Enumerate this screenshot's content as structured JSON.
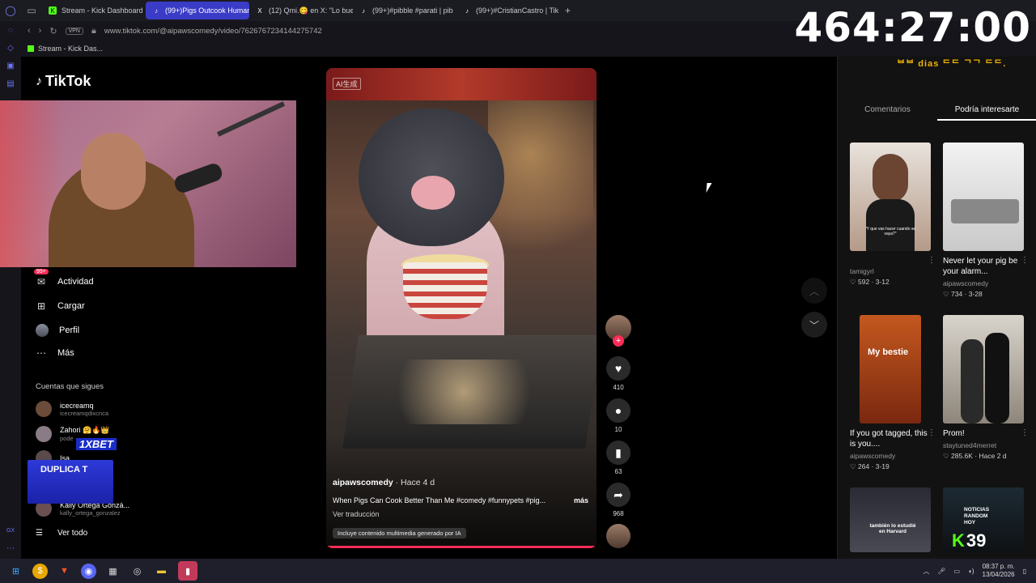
{
  "browser": {
    "tabs": [
      {
        "label": "Stream - Kick Dashboard",
        "fav_color": "#53fc18",
        "fav_glyph": "K"
      },
      {
        "label": "(99+)Pigs Outcook Human",
        "fav_color": "#111111",
        "fav_glyph": "♪",
        "active": true
      },
      {
        "label": "(12) Qmi.😋 en X: \"Lo buen",
        "fav_color": "#000000",
        "fav_glyph": "X"
      },
      {
        "label": "(99+)#pibble #parati | pib",
        "fav_color": "#111111",
        "fav_glyph": "♪"
      },
      {
        "label": "(99+)#CristianCastro | Tik",
        "fav_color": "#111111",
        "fav_glyph": "♪"
      }
    ],
    "vpn_label": "VPN",
    "url": "www.tiktok.com/@aipawscomedy/video/7626767234144275742",
    "bookmark": "Stream - Kick Das..."
  },
  "overlay": {
    "timer": "464:27:00",
    "days_partial": "ᄇᄇ dias ᄃᄃ ᄀᄀ ᄃᄃ."
  },
  "tiktok": {
    "logo_text": "TikTok",
    "nav": [
      {
        "label": "Actividad",
        "icon": "inbox-icon",
        "badge": "99+"
      },
      {
        "label": "Cargar",
        "icon": "upload-icon"
      },
      {
        "label": "Perfil",
        "icon": "profile-avatar"
      },
      {
        "label": "Más",
        "icon": "more-icon"
      }
    ],
    "following_title": "Cuentas que sigues",
    "accounts": [
      {
        "name": "icecreamq",
        "handle": "icecreamqdixcnca"
      },
      {
        "name": "Zahori 🤗🔥👑",
        "handle": "pode"
      },
      {
        "name": "Isa",
        "handle": ""
      },
      {
        "name": "Kally Ortega Gonzá...",
        "handle": "kally_ortega_gonzalez"
      }
    ],
    "see_all": "Ver todo",
    "promo_text": "DUPLICA T",
    "promo_brand": "1XBET"
  },
  "video": {
    "ai_tag": "AI生成",
    "author": "aipawscomedy",
    "when": " · Hace 4 d",
    "caption": "When Pigs Can Cook Better Than Me #comedy #funnypets #pig...",
    "more": "más",
    "translate": "Ver traducción",
    "ai_notice": "Incluye contenido multimedia generado por IA",
    "likes": "410",
    "comments": "10",
    "saves": "63",
    "shares": "968"
  },
  "right_panel": {
    "tabs": [
      "Comentarios",
      "Podría interesarte"
    ],
    "active_tab": 1,
    "cards": [
      {
        "title": "",
        "author": "tamigyrl",
        "likes": "592",
        "date": "3-12",
        "thumb_caption": "\"Y que vas hacer cuando se vaya?\""
      },
      {
        "title": "Never let your pig be your alarm...",
        "author": "aipawscomedy",
        "likes": "734",
        "date": "3-28"
      },
      {
        "title": "If you got tagged, this is you....",
        "author": "aipawscomedy",
        "likes": "264",
        "date": "3-19",
        "thumb_caption": "My bestie"
      },
      {
        "title": "Prom!",
        "author": "staytuned4merret",
        "likes": "285.6K",
        "date": "Hace 2 d"
      },
      {
        "title": "",
        "author": "",
        "likes": "",
        "date": "",
        "thumb_caption": "también lo estudié en Harvard"
      },
      {
        "title": "",
        "author": "",
        "likes": "",
        "date": "",
        "thumb_caption": "NOTICIAS RANDOM HOY"
      }
    ]
  },
  "kick": {
    "count": "39"
  },
  "taskbar": {
    "time": "08:37 p. m.",
    "date": "13/04/2026"
  }
}
